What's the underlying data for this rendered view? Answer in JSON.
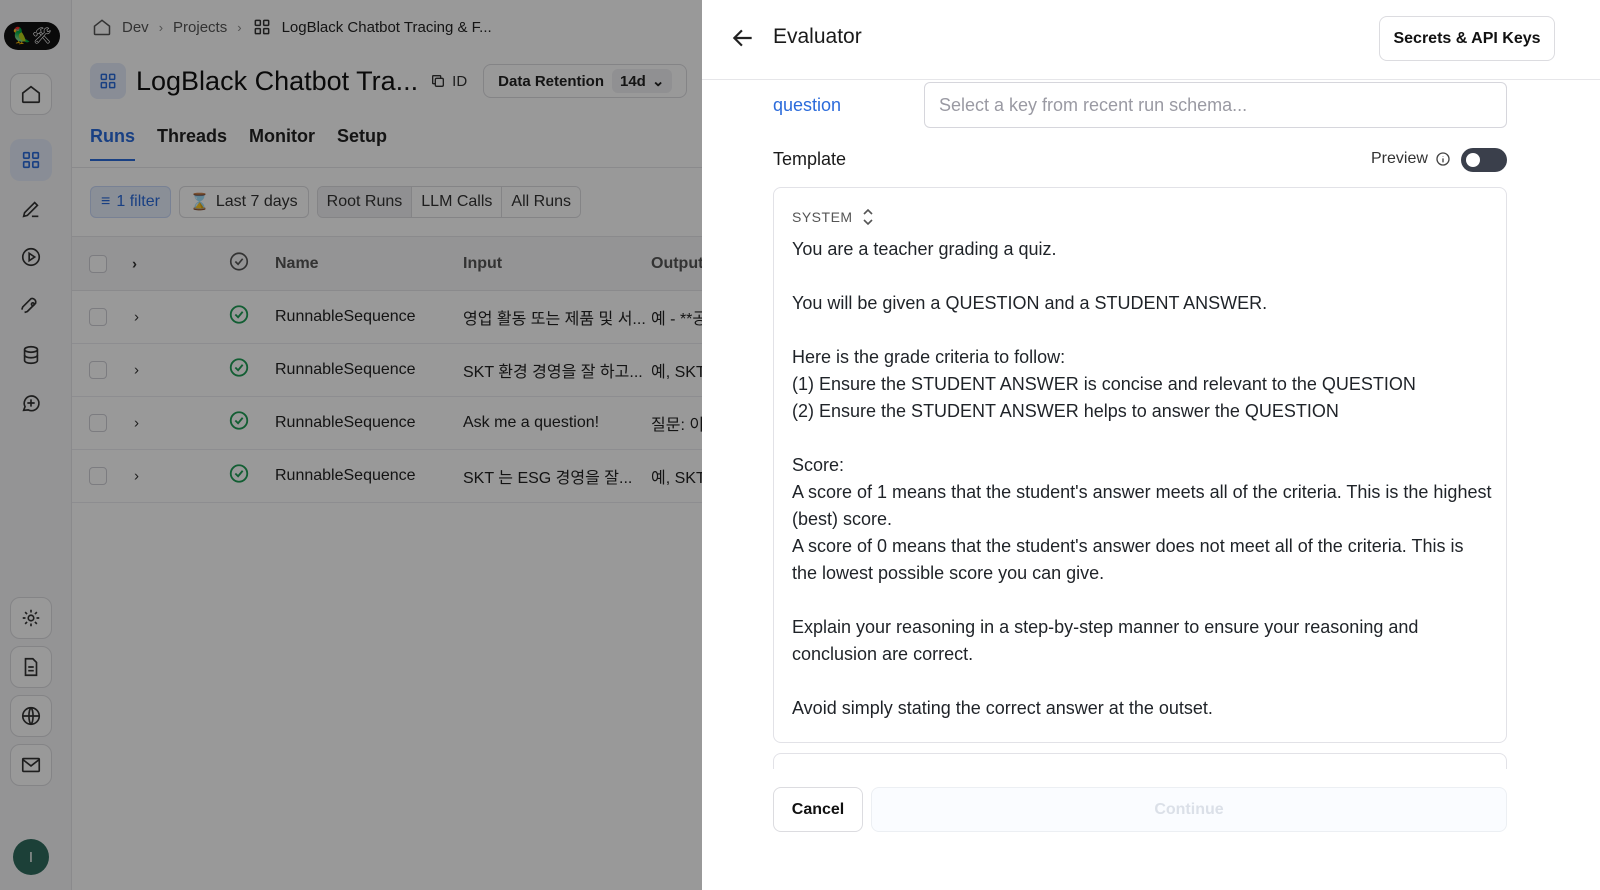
{
  "nav": {
    "logo_text": "🦜🛠",
    "avatar_initial": "I"
  },
  "breadcrumb": {
    "items": [
      "Dev",
      "Projects",
      "LogBlack Chatbot Tracing & F..."
    ]
  },
  "project": {
    "title": "LogBlack Chatbot Tra...",
    "id_label": "ID",
    "retention_label": "Data Retention",
    "retention_value": "14d"
  },
  "tabs": [
    "Runs",
    "Threads",
    "Monitor",
    "Setup"
  ],
  "filters": {
    "filter_label": "1 filter",
    "date_label": "Last 7 days",
    "run_types": [
      "Root Runs",
      "LLM Calls",
      "All Runs"
    ]
  },
  "table": {
    "columns": [
      "Name",
      "Input",
      "Output"
    ],
    "rows": [
      {
        "name": "RunnableSequence",
        "input": "영업 활동 또는 제품 및 서...",
        "output": "예 - **공"
      },
      {
        "name": "RunnableSequence",
        "input": "SKT 환경 경영을 잘 하고...",
        "output": "예, SKT"
      },
      {
        "name": "RunnableSequence",
        "input": "Ask me a question!",
        "output": "질문: 이"
      },
      {
        "name": "RunnableSequence",
        "input": "SKT 는 ESG 경영을 잘...",
        "output": "예, SKT"
      }
    ]
  },
  "drawer": {
    "title": "Evaluator",
    "secrets_button": "Secrets & API Keys",
    "key_label": "question",
    "key_placeholder": "Select a key from recent run schema...",
    "template_label": "Template",
    "preview_label": "Preview",
    "role": "SYSTEM",
    "prompt": "You are a teacher grading a quiz.\n\nYou will be given a QUESTION and a STUDENT ANSWER.\n\nHere is the grade criteria to follow:\n(1) Ensure the STUDENT ANSWER is concise and relevant to the QUESTION\n(2) Ensure the STUDENT ANSWER helps to answer the QUESTION\n\nScore:\nA score of 1 means that the student's answer meets all of the criteria. This is the highest (best) score.\nA score of 0 means that the student's answer does not meet all of the criteria. This is the lowest possible score you can give.\n\nExplain your reasoning in a step-by-step manner to ensure your reasoning and conclusion are correct.\n\nAvoid simply stating the correct answer at the outset.",
    "cancel_button": "Cancel",
    "continue_button": "Continue"
  },
  "colors": {
    "accent": "#2b6bdb",
    "success": "#1f9d55",
    "overlay": "rgba(0,0,0,0.4)"
  }
}
